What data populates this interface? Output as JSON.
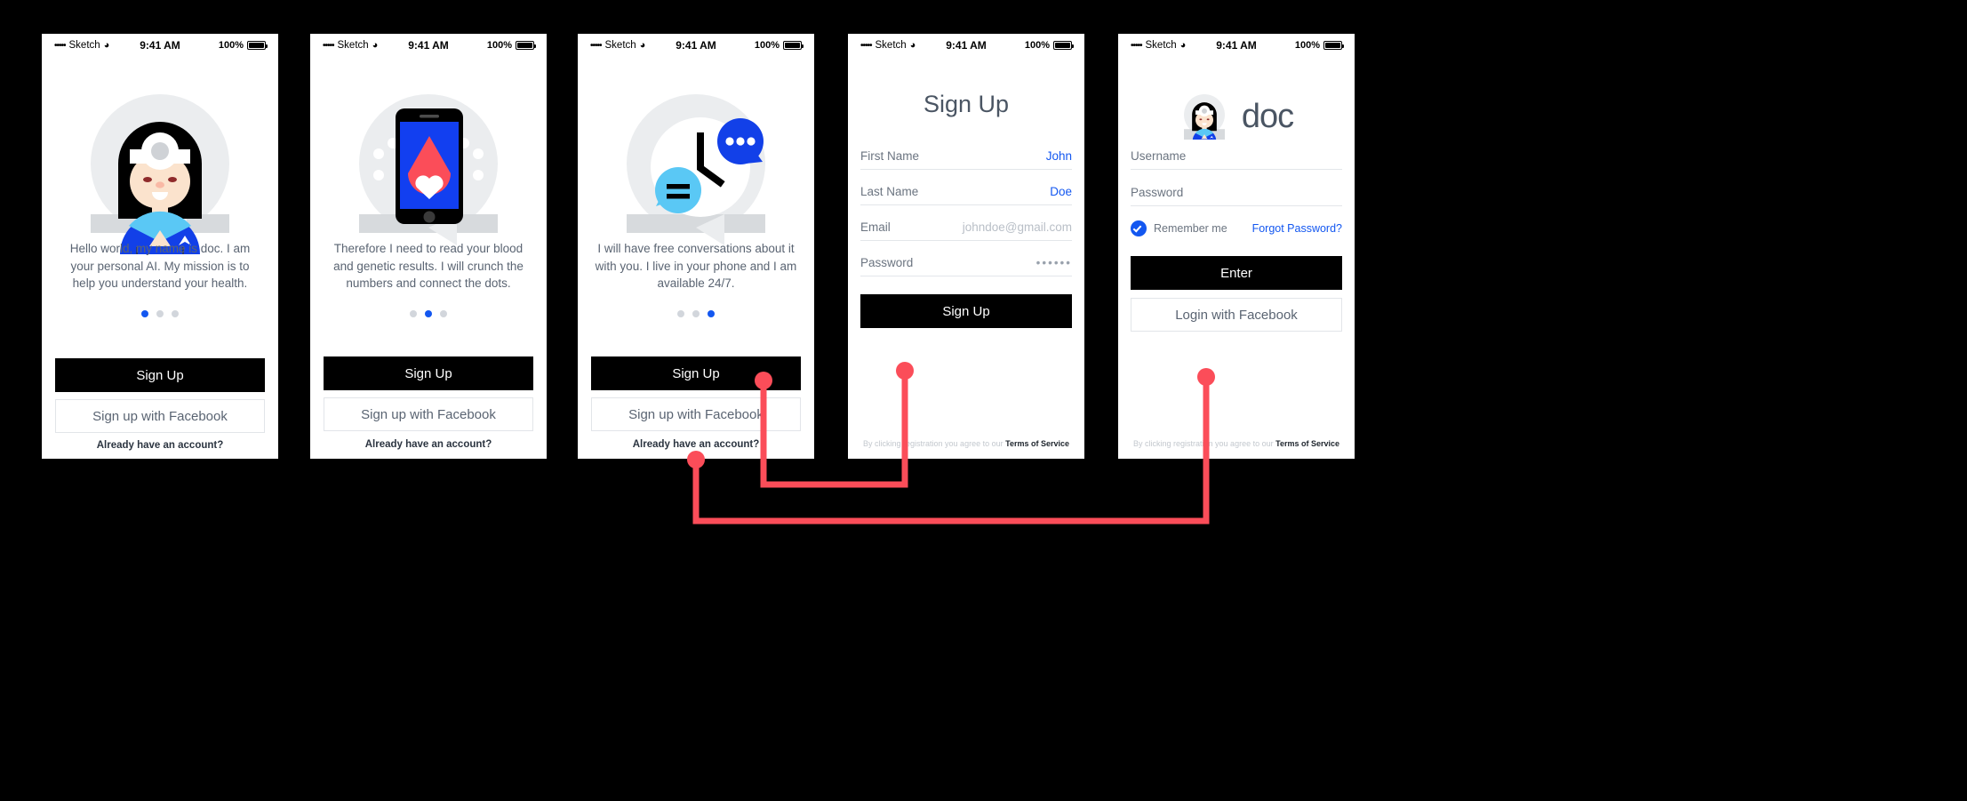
{
  "meta": {
    "accent_blue": "#1357f0",
    "light_blue": "#5ac8f5",
    "red": "#fb4d59",
    "text_gray": "#5a6472",
    "background": "#000000"
  },
  "status_bar": {
    "signal_dots": "•••••",
    "carrier": "Sketch",
    "wifi_icon": "wifi-icon",
    "time": "9:41 AM",
    "battery_percent": "100%",
    "battery_icon": "battery-full-icon"
  },
  "screens": [
    {
      "id": "onboarding-1",
      "illustration": "doctor-avatar-illustration",
      "body": "Hello world, my name is doc. I am your personal AI. My mission is to help you understand your health.",
      "active_dot": 0,
      "dot_count": 3,
      "primary_button": "Sign Up",
      "secondary_button": "Sign up with Facebook",
      "alt_link": "Already have an account?"
    },
    {
      "id": "onboarding-2",
      "illustration": "phone-blood-drop-illustration",
      "body": "Therefore I need to read your blood and genetic results. I will crunch the numbers and connect the dots.",
      "active_dot": 1,
      "dot_count": 3,
      "primary_button": "Sign Up",
      "secondary_button": "Sign up with Facebook",
      "alt_link": "Already have an account?"
    },
    {
      "id": "onboarding-3",
      "illustration": "clock-chat-bubbles-illustration",
      "body": "I will have  free conversations about it with you. I live in your phone and I am available 24/7.",
      "active_dot": 2,
      "dot_count": 3,
      "primary_button": "Sign Up",
      "secondary_button": "Sign up with Facebook",
      "alt_link": "Already have an account?"
    }
  ],
  "signup_screen": {
    "id": "sign-up",
    "title": "Sign Up",
    "fields": [
      {
        "label": "First Name",
        "value": "John",
        "type": "value"
      },
      {
        "label": "Last Name",
        "value": "Doe",
        "type": "value"
      },
      {
        "label": "Email",
        "value": "johndoe@gmail.com",
        "type": "placeholder"
      },
      {
        "label": "Password",
        "value": "••••••",
        "type": "password"
      }
    ],
    "submit_button": "Sign Up",
    "legal_prefix": "By clicking registration you agree to our ",
    "legal_link": "Terms of Service"
  },
  "login_screen": {
    "id": "login",
    "brand_avatar": "doc-avatar-icon",
    "brand_name": "doc",
    "fields": [
      {
        "label": "Username"
      },
      {
        "label": "Password"
      }
    ],
    "remember_label": "Remember me",
    "remember_checked": true,
    "forgot_link": "Forgot Password?",
    "submit_button": "Enter",
    "facebook_button": "Login with Facebook",
    "legal_prefix": "By clicking registration you agree to our ",
    "legal_link": "Terms of Service"
  },
  "flow_connectors": [
    {
      "from": "onboarding-3 Sign Up button",
      "to": "sign-up screen",
      "color": "#fb4d59"
    },
    {
      "from": "onboarding-3 Already have an account?",
      "to": "login screen",
      "color": "#fb4d59"
    }
  ]
}
